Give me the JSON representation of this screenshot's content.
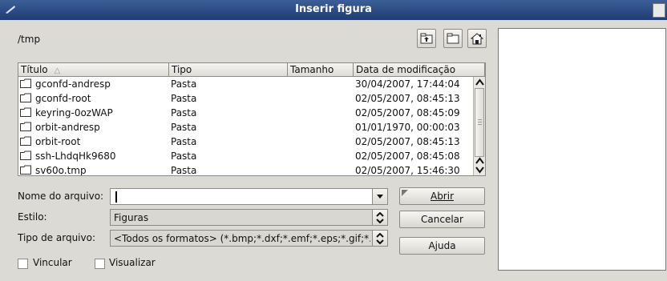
{
  "window": {
    "title": "Inserir figura"
  },
  "path": "/tmp",
  "toolbar": {
    "up_icon": "up-folder-icon",
    "new_folder_icon": "new-folder-icon",
    "home_icon": "home-icon"
  },
  "table": {
    "headers": [
      "Título",
      "Tipo",
      "Tamanho",
      "Data de modificação"
    ],
    "rows": [
      {
        "name": "gconfd-andresp",
        "type": "Pasta",
        "size": "",
        "date": "30/04/2007, 17:44:04"
      },
      {
        "name": "gconfd-root",
        "type": "Pasta",
        "size": "",
        "date": "02/05/2007, 08:45:13"
      },
      {
        "name": "keyring-0ozWAP",
        "type": "Pasta",
        "size": "",
        "date": "02/05/2007, 08:45:09"
      },
      {
        "name": "orbit-andresp",
        "type": "Pasta",
        "size": "",
        "date": "01/01/1970, 00:00:03"
      },
      {
        "name": "orbit-root",
        "type": "Pasta",
        "size": "",
        "date": "02/05/2007, 08:45:13"
      },
      {
        "name": "ssh-LhdqHk9680",
        "type": "Pasta",
        "size": "",
        "date": "02/05/2007, 08:45:08"
      },
      {
        "name": "sv60o.tmp",
        "type": "Pasta",
        "size": "",
        "date": "02/05/2007, 15:46:30"
      }
    ]
  },
  "form": {
    "filename_label": "Nome do arquivo:",
    "filename_value": "",
    "style_label": "Estilo:",
    "style_value": "Figuras",
    "filetype_label": "Tipo de arquivo:",
    "filetype_value": "<Todos os formatos> (*.bmp;*.dxf;*.emf;*.eps;*.gif;*.jpg"
  },
  "buttons": {
    "open": "Abrir",
    "cancel": "Cancelar",
    "help": "Ajuda"
  },
  "checkboxes": {
    "link": "Vincular",
    "preview": "Visualizar"
  }
}
